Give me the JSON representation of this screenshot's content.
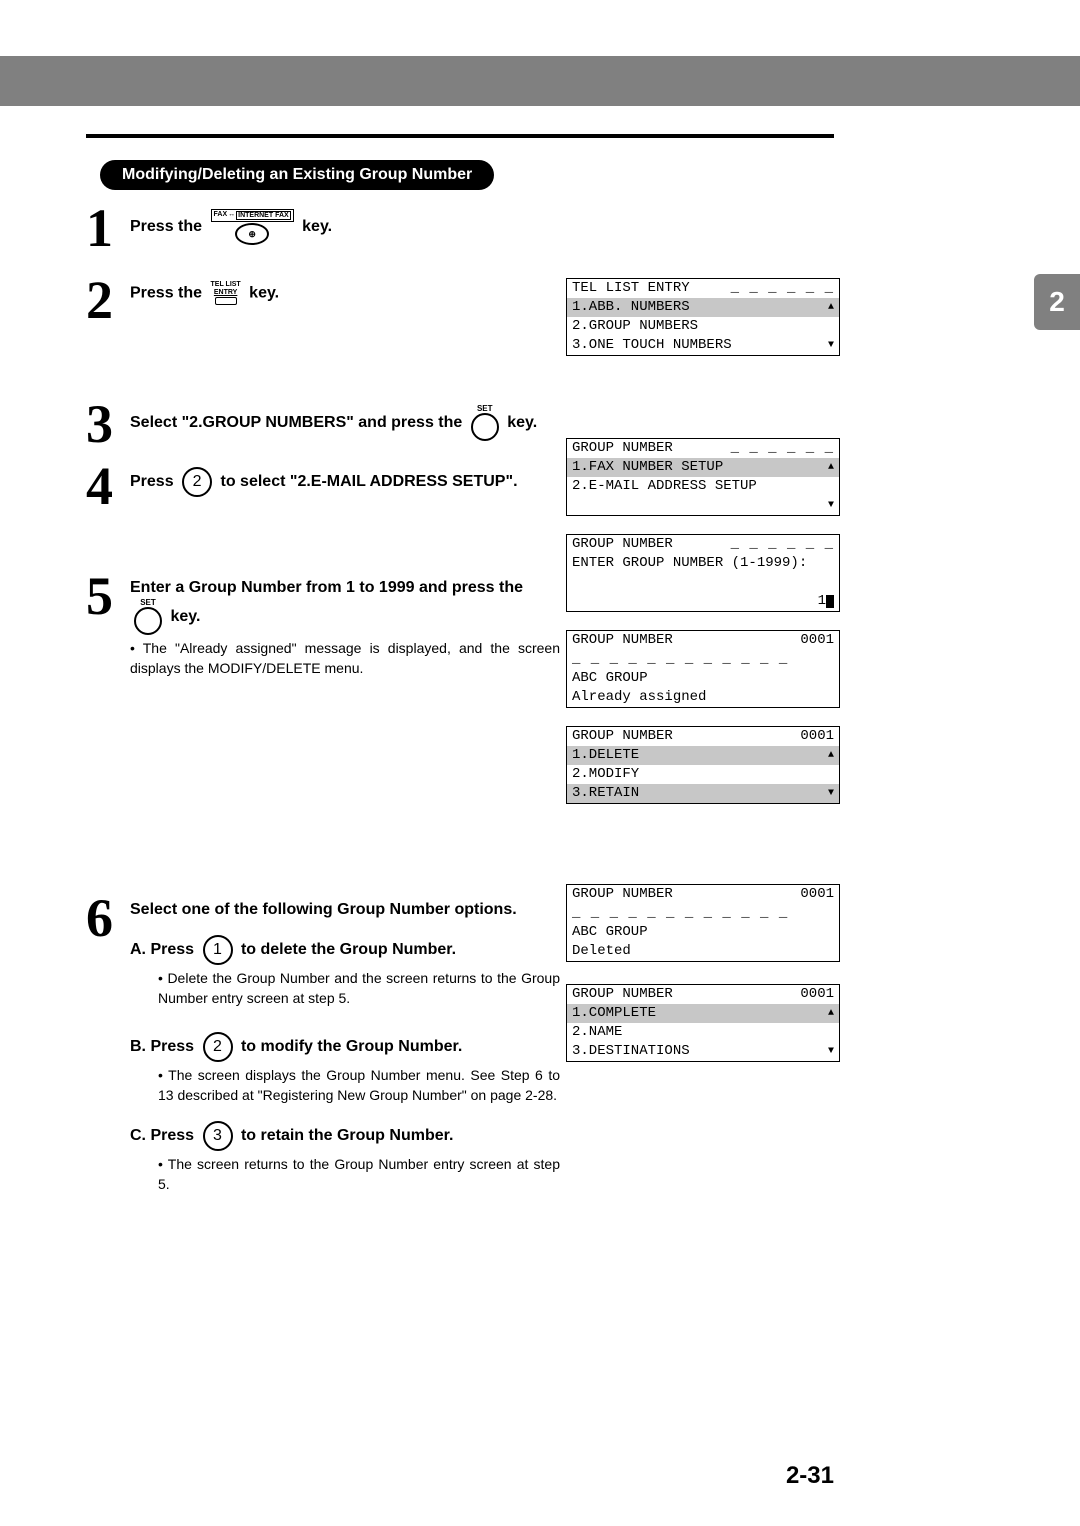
{
  "header": {
    "section_title": "Modifying/Deleting an Existing Group Number",
    "side_tab": "2",
    "page_number": "2-31"
  },
  "keys": {
    "fax_label_left": "FAX",
    "fax_label_right": "INTERNET FAX",
    "fax_glyph": "↔",
    "entry_top": "TEL LIST",
    "entry_mid": "ENTRY",
    "set_label": "SET"
  },
  "steps": {
    "s1": {
      "num": "1",
      "a": "Press the",
      "b": "key."
    },
    "s2": {
      "num": "2",
      "a": "Press the",
      "b": "key."
    },
    "s3": {
      "num": "3",
      "a": "Select \"2.GROUP NUMBERS\" and press the",
      "b": "key."
    },
    "s4": {
      "num": "4",
      "a": "Press",
      "key": "2",
      "b": "to select \"2.E-MAIL ADDRESS SETUP\"."
    },
    "s5": {
      "num": "5",
      "a": "Enter a Group Number from 1 to 1999 and press the",
      "b": "key.",
      "bullet": "• The \"Already assigned\" message is displayed, and the screen displays the MODIFY/DELETE menu."
    },
    "s6": {
      "num": "6",
      "title": "Select one of the following Group Number options.",
      "A": {
        "label": "A.  Press",
        "key": "1",
        "tail": "to delete the Group Number.",
        "bullet": "• Delete the Group Number and the screen returns to the Group Number entry screen at step 5."
      },
      "B": {
        "label": "B.  Press",
        "key": "2",
        "tail": "to modify the Group Number.",
        "bullet": "• The screen displays the Group Number menu.  See Step 6 to 13 described at \"Registering New Group Number\" on page 2-28."
      },
      "C": {
        "label": "C.  Press",
        "key": "3",
        "tail": "to retain the Group Number.",
        "bullet": "• The screen returns to the Group Number entry screen at step 5."
      }
    }
  },
  "lcd": {
    "tel_list": {
      "r1": "TEL LIST ENTRY",
      "r2": "1.ABB. NUMBERS",
      "r3": "2.GROUP NUMBERS",
      "r4": "3.ONE TOUCH NUMBERS"
    },
    "group_menu": {
      "r1": "GROUP NUMBER",
      "r2": "1.FAX NUMBER SETUP",
      "r3": "2.E-MAIL ADDRESS SETUP"
    },
    "enter": {
      "r1": "GROUP NUMBER",
      "r2": "ENTER GROUP NUMBER (1-1999):",
      "r4": "1"
    },
    "assigned": {
      "r1l": "GROUP NUMBER",
      "r1r": "0001",
      "r3": "ABC GROUP",
      "r4": "Already assigned"
    },
    "options": {
      "r1l": "GROUP NUMBER",
      "r1r": "0001",
      "r2": "1.DELETE",
      "r3": "2.MODIFY",
      "r4": "3.RETAIN"
    },
    "deleted": {
      "r1l": "GROUP NUMBER",
      "r1r": "0001",
      "r3": "ABC GROUP",
      "r4": "Deleted"
    },
    "modify": {
      "r1l": "GROUP NUMBER",
      "r1r": "0001",
      "r2": "1.COMPLETE",
      "r3": "2.NAME",
      "r4": "3.DESTINATIONS"
    }
  }
}
